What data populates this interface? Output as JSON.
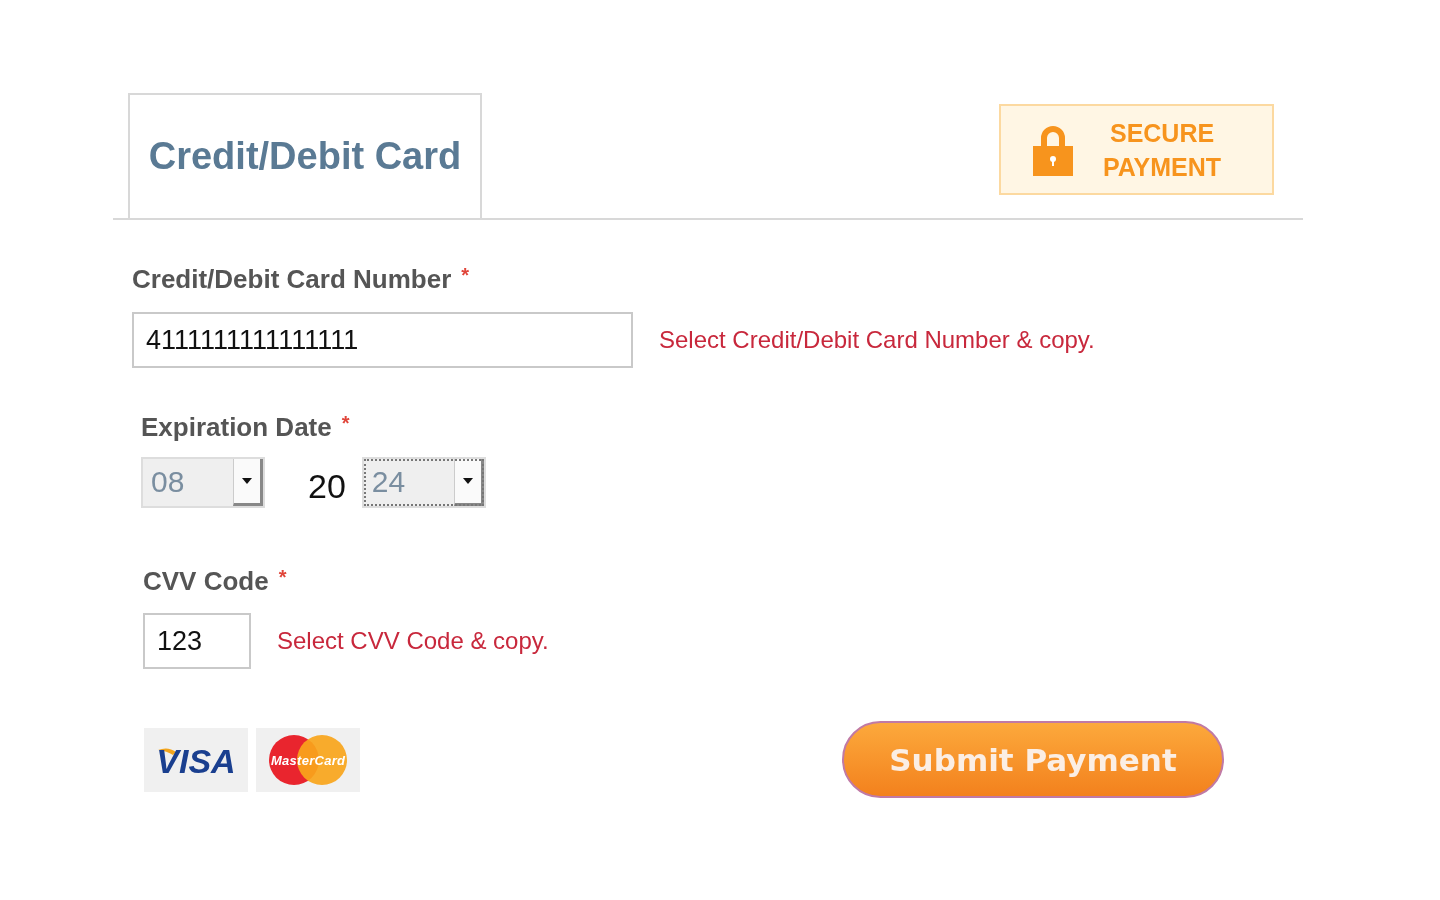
{
  "tabs": [
    {
      "label": "Credit/Debit Card",
      "selected": true
    }
  ],
  "secure_badge": {
    "line_1": "SECURE",
    "line_2": "PAYMENT"
  },
  "card_number": {
    "label": "Credit/Debit Card Number",
    "required_mark": "*",
    "value": "4111111111111111",
    "hint": "Select Credit/Debit Card Number & copy."
  },
  "expiration": {
    "label": "Expiration Date",
    "required_mark": "*",
    "month": {
      "value": "08",
      "focused": false
    },
    "century": "20",
    "year": {
      "value": "24",
      "focused": true
    }
  },
  "cvv": {
    "label": "CVV Code",
    "required_mark": "*",
    "value": "123",
    "hint": "Select CVV Code & copy."
  },
  "card_logos": [
    {
      "kind": "visa",
      "text": "VISA"
    },
    {
      "kind": "mastercard",
      "text": "MasterCard"
    }
  ],
  "submit_button": "Submit Payment"
}
